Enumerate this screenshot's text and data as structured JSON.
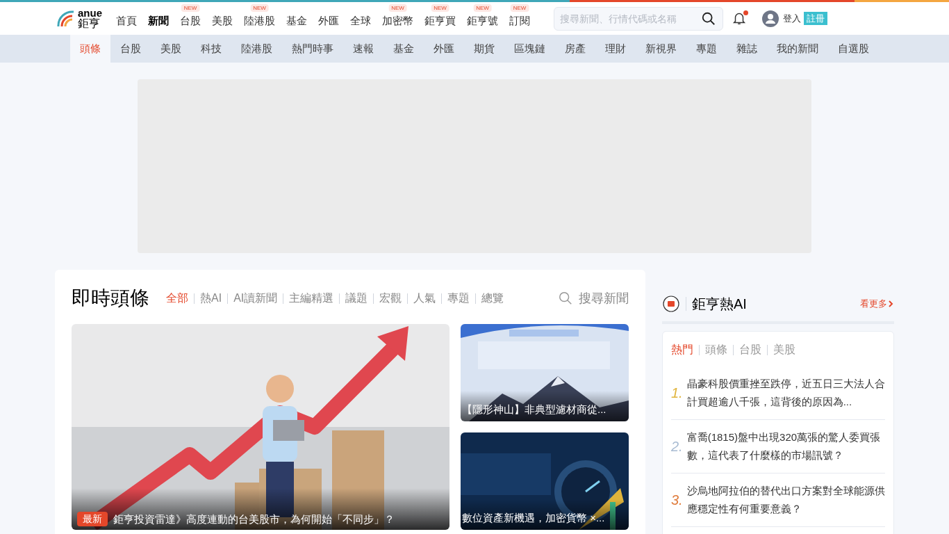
{
  "logo": {
    "top": "anue",
    "bottom": "鉅亨"
  },
  "nav": [
    {
      "label": "首頁",
      "selected": false
    },
    {
      "label": "新聞",
      "selected": true
    },
    {
      "label": "台股",
      "selected": false,
      "badge": "NEW"
    },
    {
      "label": "美股",
      "selected": false
    },
    {
      "label": "陸港股",
      "selected": false,
      "badge": "NEW"
    },
    {
      "label": "基金",
      "selected": false
    },
    {
      "label": "外匯",
      "selected": false
    },
    {
      "label": "全球",
      "selected": false
    },
    {
      "label": "加密幣",
      "selected": false,
      "badge": "NEW"
    },
    {
      "label": "鉅亨買",
      "selected": false,
      "badge": "NEW"
    },
    {
      "label": "鉅亨號",
      "selected": false,
      "badge": "NEW"
    },
    {
      "label": "訂閱",
      "selected": false,
      "badge": "NEW"
    }
  ],
  "search": {
    "placeholder": "搜尋新聞、行情代碼或名稱"
  },
  "notifications": {
    "unread": true
  },
  "account": {
    "login": "登入",
    "register": "註冊"
  },
  "subnav": [
    {
      "label": "頭條",
      "selected": true
    },
    {
      "label": "台股",
      "selected": false
    },
    {
      "label": "美股",
      "selected": false
    },
    {
      "label": "科技",
      "selected": false
    },
    {
      "label": "陸港股",
      "selected": false
    },
    {
      "label": "熱門時事",
      "selected": false
    },
    {
      "label": "速報",
      "selected": false
    },
    {
      "label": "基金",
      "selected": false
    },
    {
      "label": "外匯",
      "selected": false
    },
    {
      "label": "期貨",
      "selected": false
    },
    {
      "label": "區塊鏈",
      "selected": false
    },
    {
      "label": "房產",
      "selected": false
    },
    {
      "label": "理財",
      "selected": false
    },
    {
      "label": "新視界",
      "selected": false
    },
    {
      "label": "專題",
      "selected": false
    },
    {
      "label": "雜誌",
      "selected": false
    },
    {
      "label": "我的新聞",
      "selected": false
    },
    {
      "label": "自選股",
      "selected": false
    }
  ],
  "headlines": {
    "title": "即時頭條",
    "filters": [
      {
        "label": "全部",
        "selected": true
      },
      {
        "label": "熱AI",
        "selected": false
      },
      {
        "label": "AI讀新聞",
        "selected": false
      },
      {
        "label": "主編精選",
        "selected": false
      },
      {
        "label": "議題",
        "selected": false
      },
      {
        "label": "宏觀",
        "selected": false
      },
      {
        "label": "人氣",
        "selected": false
      },
      {
        "label": "專題",
        "selected": false
      },
      {
        "label": "總覽",
        "selected": false
      }
    ],
    "search_label": "搜尋新聞",
    "main_story": {
      "badge": "最新",
      "title": "鉅亨投資雷達》高度連動的台美股市，為何開始「不同步」？"
    },
    "side_stories": [
      {
        "title": "【隱形神山】非典型濾材商從...",
        "kind": "mountain"
      },
      {
        "title": "數位資產新機遇，加密貨幣 ×...",
        "kind": "clock"
      }
    ]
  },
  "hot_ai": {
    "title": "鉅亨熱AI",
    "more": "看更多",
    "tabs": [
      {
        "label": "熱門",
        "selected": true
      },
      {
        "label": "頭條",
        "selected": false
      },
      {
        "label": "台股",
        "selected": false
      },
      {
        "label": "美股",
        "selected": false
      }
    ],
    "items": [
      {
        "rank": "1.",
        "color": "#e0b43c",
        "title": "晶豪科股價重挫至跌停，近五日三大法人合計買超逾八千張，這背後的原因為..."
      },
      {
        "rank": "2.",
        "color": "#a9bcd3",
        "title": "富喬(1815)盤中出現320萬張的驚人委買張數，這代表了什麼樣的市場訊號？"
      },
      {
        "rank": "3.",
        "color": "#e07c3c",
        "title": "沙烏地阿拉伯的替代出口方案對全球能源供應穩定性有何重要意義？"
      }
    ]
  }
}
